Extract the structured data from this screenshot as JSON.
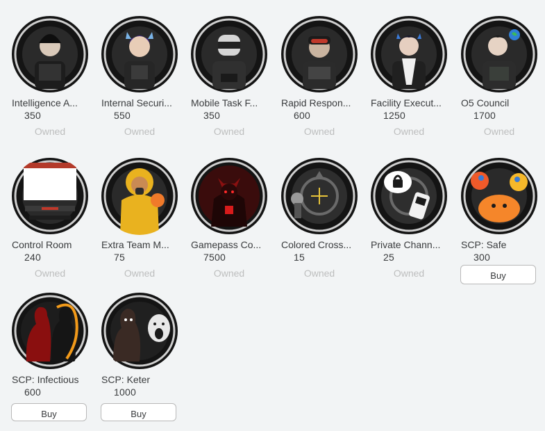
{
  "colors": {
    "background": "#f2f4f5",
    "text": "#393b3d",
    "owned_text": "#bdbebe",
    "button_border": "#b8b8b8"
  },
  "passes": [
    {
      "name": "Intelligence A...",
      "price": "350",
      "status": "Owned",
      "icon": "intelligence-agent-avatar-icon"
    },
    {
      "name": "Internal Securi...",
      "price": "550",
      "status": "Owned",
      "icon": "internal-security-avatar-icon"
    },
    {
      "name": "Mobile Task F...",
      "price": "350",
      "status": "Owned",
      "icon": "mobile-task-force-avatar-icon"
    },
    {
      "name": "Rapid Respon...",
      "price": "600",
      "status": "Owned",
      "icon": "rapid-response-avatar-icon"
    },
    {
      "name": "Facility Execut...",
      "price": "1250",
      "status": "Owned",
      "icon": "facility-executive-avatar-icon"
    },
    {
      "name": "O5 Council",
      "price": "1700",
      "status": "Owned",
      "icon": "o5-council-avatar-icon"
    },
    {
      "name": "Control Room",
      "price": "240",
      "status": "Owned",
      "icon": "control-room-icon"
    },
    {
      "name": "Extra Team M...",
      "price": "75",
      "status": "Owned",
      "icon": "extra-team-member-icon"
    },
    {
      "name": "Gamepass Co...",
      "price": "7500",
      "status": "Owned",
      "icon": "gamepass-collection-icon"
    },
    {
      "name": "Colored Cross...",
      "price": "15",
      "status": "Owned",
      "icon": "colored-crosshair-icon"
    },
    {
      "name": "Private Chann...",
      "price": "25",
      "status": "Owned",
      "icon": "private-channel-icon"
    },
    {
      "name": "SCP: Safe",
      "price": "300",
      "status": "Buy",
      "icon": "scp-safe-icon"
    },
    {
      "name": "SCP: Infectious",
      "price": "600",
      "status": "Buy",
      "icon": "scp-infectious-icon"
    },
    {
      "name": "SCP: Keter",
      "price": "1000",
      "status": "Buy",
      "icon": "scp-keter-icon"
    }
  ]
}
